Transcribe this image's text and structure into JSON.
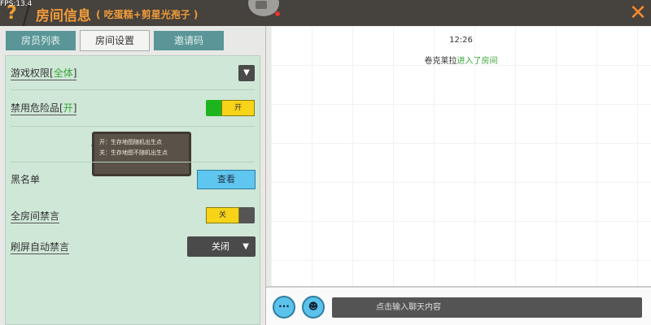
{
  "fps": "FPS:13.4",
  "header": {
    "title": "房间信息",
    "subtitle": "( 吃蛋糕+剪星光孢子 )",
    "help": "?",
    "close": "✕"
  },
  "tabs": [
    {
      "label": "房员列表"
    },
    {
      "label": "房间设置"
    },
    {
      "label": "邀请码"
    }
  ],
  "active_tab": 1,
  "settings": {
    "game_permission": {
      "label": "游戏权限",
      "value": "全体"
    },
    "ban_dangerous": {
      "label": "禁用危险品",
      "value": "开",
      "toggle": "开",
      "on": true
    },
    "tooltip": {
      "line1": "开：生存地图随机出生点",
      "line2": "关：生存地图不随机出生点"
    },
    "blacklist": {
      "label": "黑名单",
      "button": "查看"
    },
    "mute_all": {
      "label": "全房间禁言",
      "toggle": "关",
      "on": false
    },
    "spam_mute": {
      "label": "刷屏自动禁言",
      "value": "关闭"
    }
  },
  "chat": {
    "time": "12:26",
    "sender": "卷克莱拉",
    "action": "进入了房间",
    "placeholder": "点击输入聊天内容"
  },
  "colors": {
    "accent": "#f09a3a",
    "panel": "#cfe7d7",
    "green": "#3aa63a"
  }
}
